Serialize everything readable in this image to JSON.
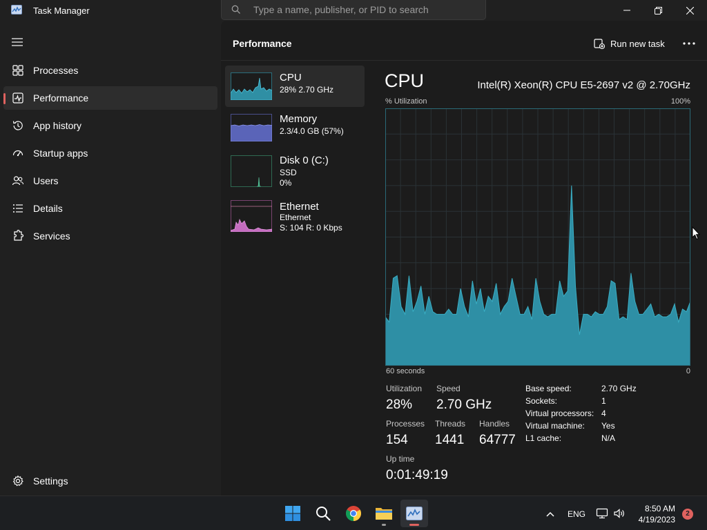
{
  "titlebar": {
    "app_title": "Task Manager",
    "search_placeholder": "Type a name, publisher, or PID to search"
  },
  "sidebar": {
    "items": [
      {
        "label": "Processes",
        "icon": "processes-grid-icon",
        "active": false
      },
      {
        "label": "Performance",
        "icon": "performance-pulse-icon",
        "active": true
      },
      {
        "label": "App history",
        "icon": "history-clock-icon",
        "active": false
      },
      {
        "label": "Startup apps",
        "icon": "startup-gauge-icon",
        "active": false
      },
      {
        "label": "Users",
        "icon": "users-icon",
        "active": false
      },
      {
        "label": "Details",
        "icon": "details-list-icon",
        "active": false
      },
      {
        "label": "Services",
        "icon": "services-puzzle-icon",
        "active": false
      }
    ],
    "settings_label": "Settings"
  },
  "header": {
    "title": "Performance",
    "run_new_task": "Run new task"
  },
  "devices": [
    {
      "title": "CPU",
      "lines": [
        "28%  2.70 GHz"
      ],
      "color": "#3aaec4"
    },
    {
      "title": "Memory",
      "lines": [
        "2.3/4.0 GB (57%)"
      ],
      "color": "#6e7bd6"
    },
    {
      "title": "Disk 0 (C:)",
      "lines": [
        "SSD",
        "0%"
      ],
      "color": "#4fbf9a"
    },
    {
      "title": "Ethernet",
      "lines": [
        "Ethernet",
        "S: 104  R: 0 Kbps"
      ],
      "color": "#d178c4"
    }
  ],
  "detail": {
    "title": "CPU",
    "model": "Intel(R) Xeon(R) CPU E5-2697 v2 @ 2.70GHz",
    "y_label": "% Utilization",
    "y_max": "100%",
    "x_label": "60 seconds",
    "x_end": "0",
    "stats": {
      "utilization_label": "Utilization",
      "utilization": "28%",
      "speed_label": "Speed",
      "speed": "2.70 GHz",
      "processes_label": "Processes",
      "processes": "154",
      "threads_label": "Threads",
      "threads": "1441",
      "handles_label": "Handles",
      "handles": "64777",
      "uptime_label": "Up time",
      "uptime": "0:01:49:19"
    },
    "specs": [
      {
        "key": "Base speed:",
        "value": "2.70 GHz"
      },
      {
        "key": "Sockets:",
        "value": "1"
      },
      {
        "key": "Virtual processors:",
        "value": "4"
      },
      {
        "key": "Virtual machine:",
        "value": "Yes"
      },
      {
        "key": "L1 cache:",
        "value": "N/A"
      }
    ]
  },
  "chart_data": {
    "type": "area",
    "y_range": [
      0,
      100
    ],
    "x_range": [
      60,
      0
    ],
    "grid": true,
    "color": "#3aaec4",
    "values": [
      19,
      17,
      34,
      35,
      23,
      20,
      35,
      21,
      25,
      31,
      20,
      27,
      21,
      20,
      20,
      20,
      22,
      20,
      20,
      30,
      23,
      19,
      33,
      24,
      30,
      21,
      27,
      25,
      32,
      20,
      23,
      25,
      34,
      27,
      20,
      20,
      23,
      18,
      34,
      25,
      20,
      19,
      20,
      20,
      33,
      27,
      29,
      70,
      31,
      12,
      20,
      20,
      19,
      21,
      20,
      20,
      23,
      33,
      32,
      18,
      19,
      18,
      36,
      25,
      20,
      20,
      22,
      24,
      19,
      20,
      19,
      19,
      20,
      24,
      17,
      22,
      21,
      25
    ]
  },
  "taskbar": {
    "apps": [
      "windows-start-icon",
      "search-icon",
      "chrome-icon",
      "file-explorer-icon",
      "task-manager-icon"
    ],
    "lang": "ENG",
    "time": "8:50 AM",
    "date": "4/19/2023",
    "notifications": "2"
  }
}
